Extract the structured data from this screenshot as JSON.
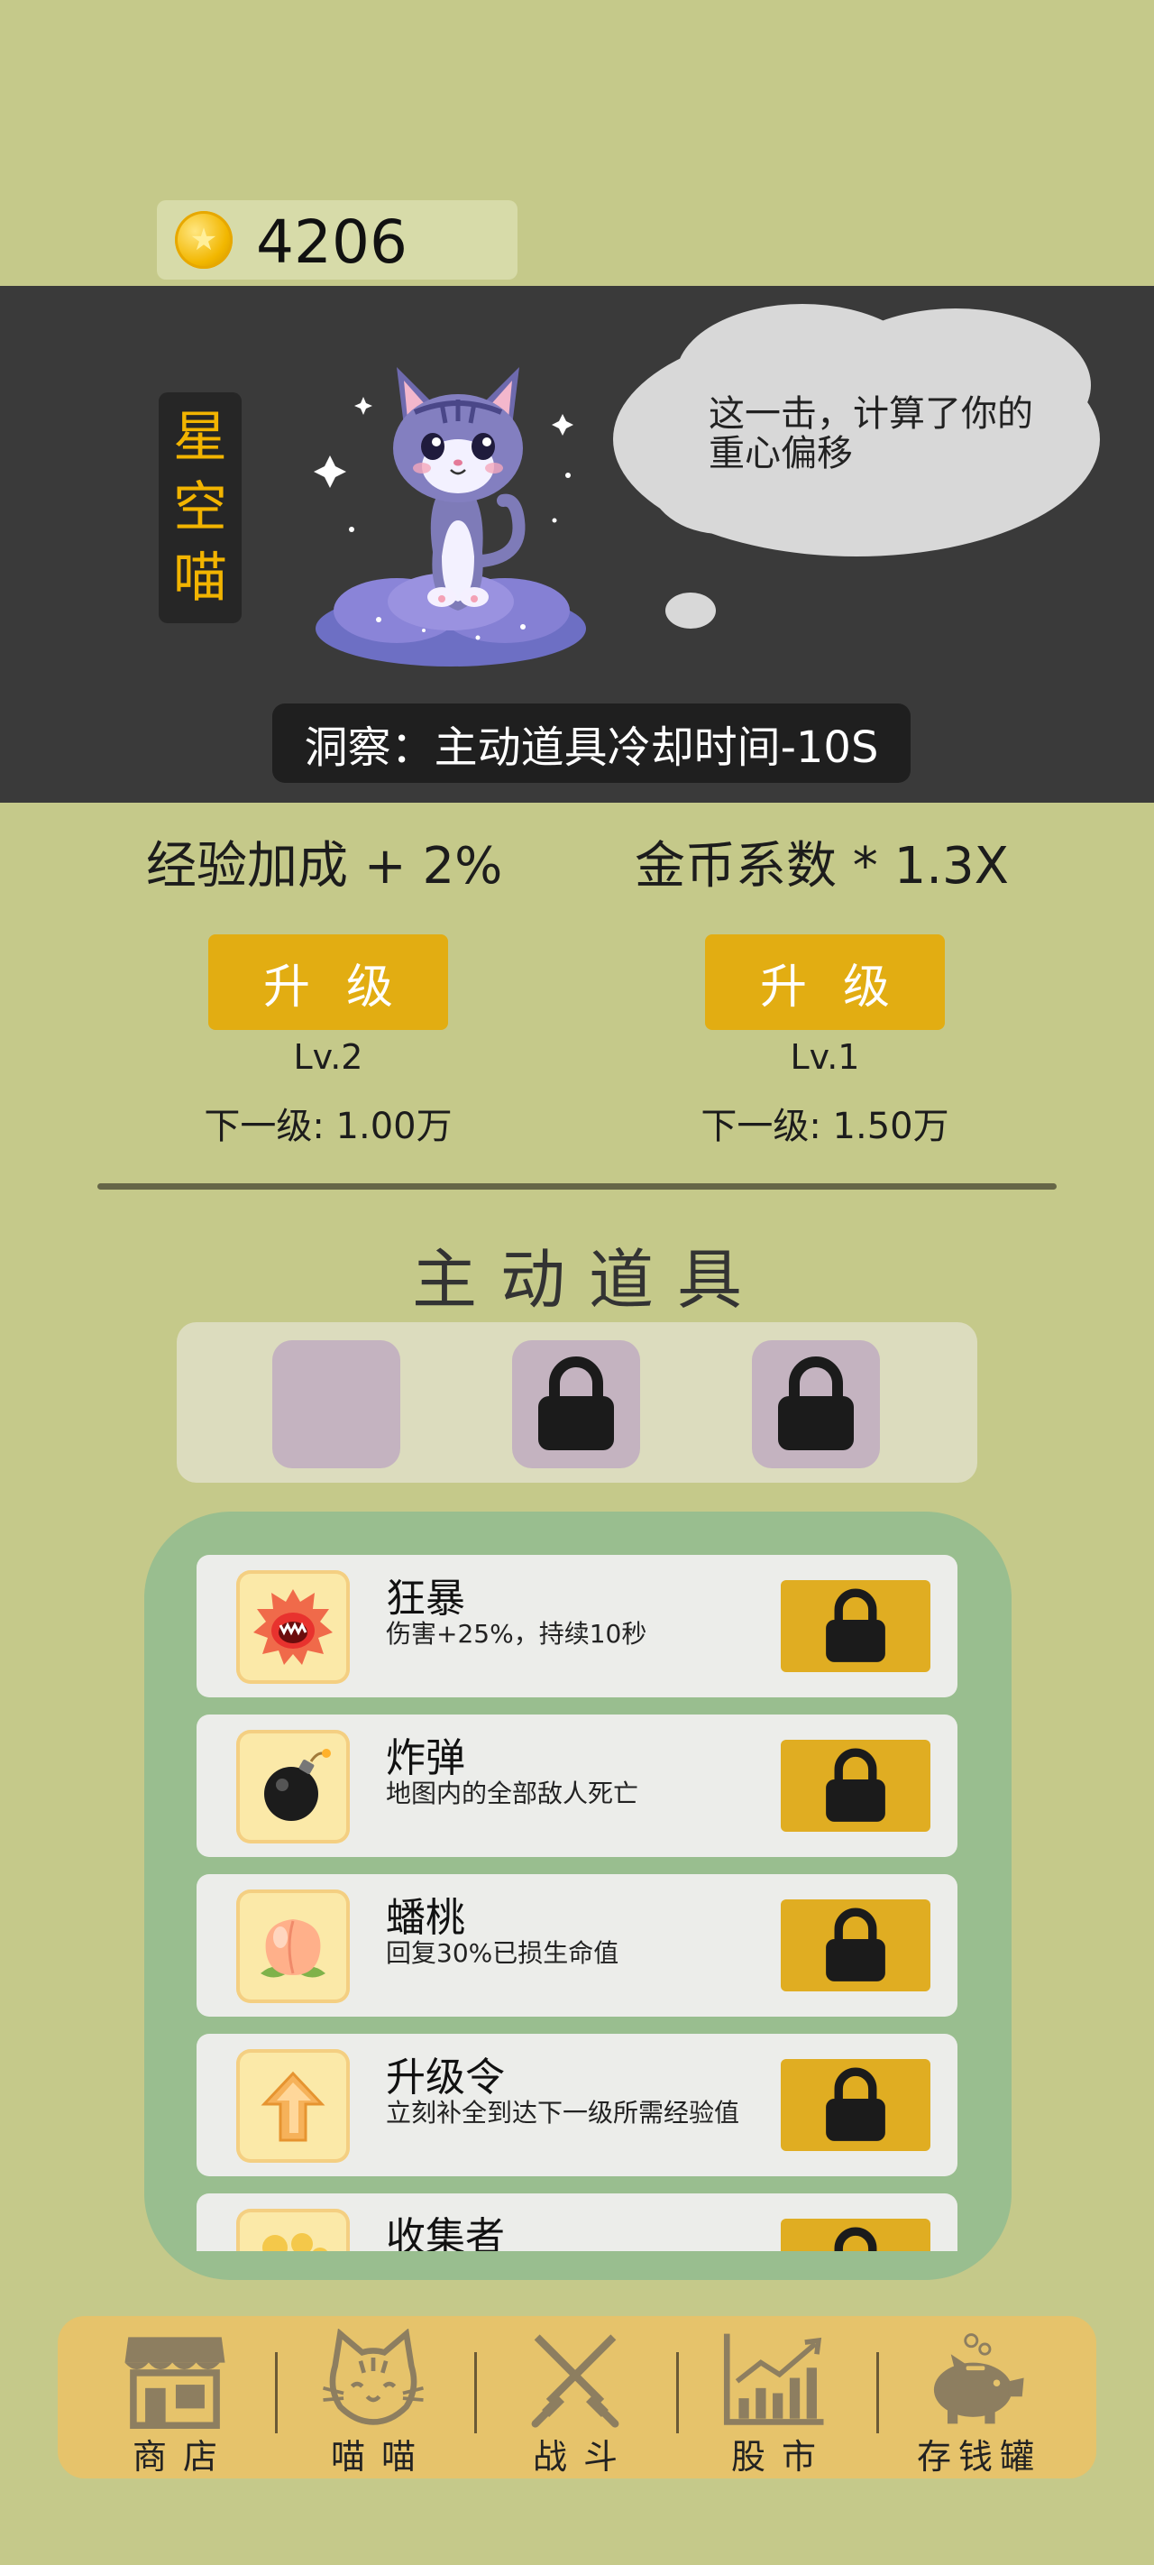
{
  "coins": {
    "value": "4206",
    "icon": "coin-star-icon"
  },
  "hero": {
    "name": "星空喵",
    "name_chars": [
      "星",
      "空",
      "喵"
    ],
    "speech": "这一击，计算了你的重心偏移",
    "skill": "洞察：主动道具冷却时间-10S"
  },
  "stats": [
    {
      "label": "经验加成 + 2%",
      "button": "升级",
      "level": "Lv.2",
      "next": "下一级: 1.00万"
    },
    {
      "label": "金币系数 * 1.3X",
      "button": "升级",
      "level": "Lv.1",
      "next": "下一级: 1.50万"
    }
  ],
  "active_items": {
    "title": "主动道具",
    "slots": [
      {
        "state": "empty"
      },
      {
        "state": "locked",
        "icon": "lock-icon"
      },
      {
        "state": "locked",
        "icon": "lock-icon"
      }
    ]
  },
  "items": [
    {
      "name": "狂暴",
      "desc": "伤害+25%，持续10秒",
      "icon": "rage-face-icon"
    },
    {
      "name": "炸弹",
      "desc": "地图内的全部敌人死亡",
      "icon": "bomb-icon"
    },
    {
      "name": "蟠桃",
      "desc": "回复30%已损生命值",
      "icon": "peach-icon"
    },
    {
      "name": "升级令",
      "desc": "立刻补全到达下一级所需经验值",
      "icon": "up-arrow-icon"
    },
    {
      "name": "收集者",
      "desc": "",
      "icon": "coins-icon"
    }
  ],
  "nav": [
    {
      "label": "商店",
      "icon": "shop-icon"
    },
    {
      "label": "喵喵",
      "icon": "cat-face-icon"
    },
    {
      "label": "战斗",
      "icon": "crossed-swords-icon"
    },
    {
      "label": "股市",
      "icon": "stock-chart-icon"
    },
    {
      "label": "存钱罐",
      "icon": "piggy-bank-icon"
    }
  ],
  "colors": {
    "background": "#c5c98a",
    "hero_band": "#3a3a3a",
    "accent_gold": "#e2ad12",
    "items_panel": "#99be8f",
    "nav_bar": "#e6c36b"
  }
}
